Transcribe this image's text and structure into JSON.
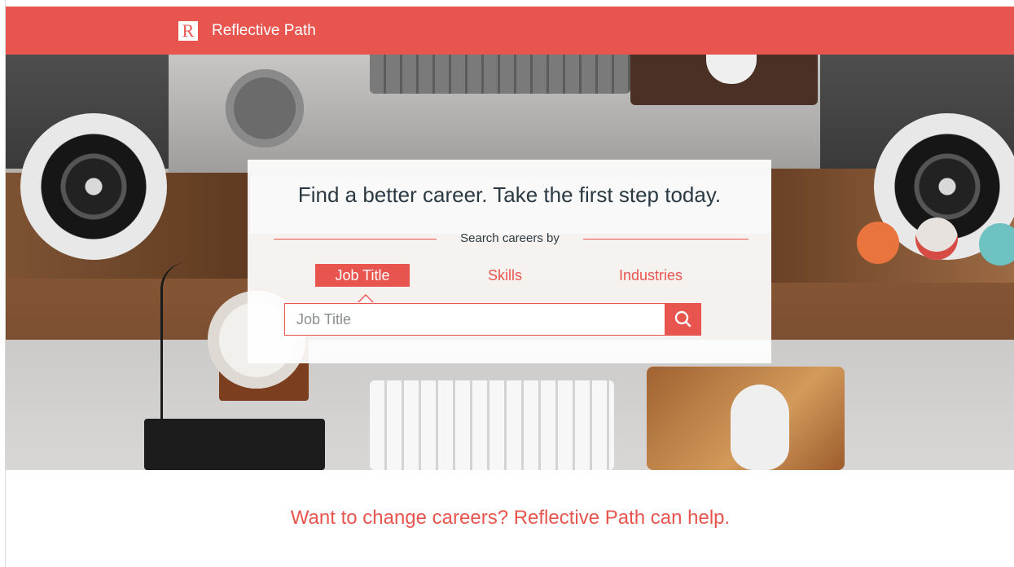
{
  "header": {
    "logo_letter": "R",
    "brand_name": "Reflective Path"
  },
  "hero": {
    "headline": "Find a better career. Take the first step today.",
    "search_by_label": "Search careers by",
    "tabs": [
      {
        "label": "Job Title",
        "active": true
      },
      {
        "label": "Skills",
        "active": false
      },
      {
        "label": "Industries",
        "active": false
      }
    ],
    "search": {
      "placeholder": "Job Title",
      "value": "",
      "button_icon": "search-icon"
    }
  },
  "main": {
    "tagline": "Want to change careers? Reflective Path can help."
  },
  "colors": {
    "accent": "#e8554e",
    "text_dark": "#2b3a42",
    "background": "#ffffff"
  }
}
